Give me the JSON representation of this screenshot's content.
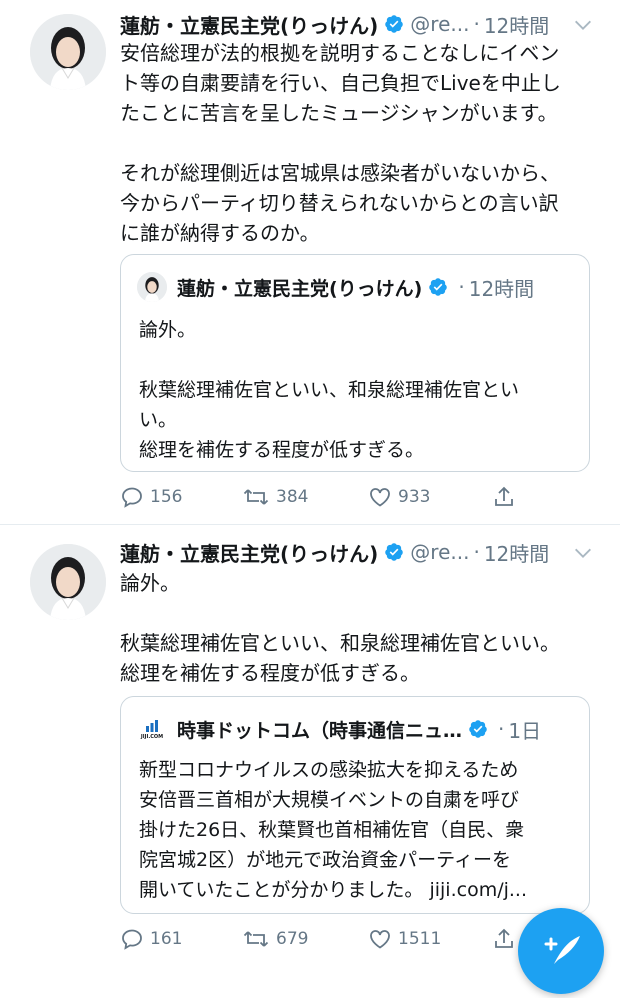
{
  "colors": {
    "accent": "#1da1f2",
    "muted": "#657786",
    "border": "#ccd6dd"
  },
  "tweets": [
    {
      "name": "蓮舫・立憲民主党(りっけん)",
      "handle": "@re...",
      "dot": "·",
      "time": "12時間",
      "body": [
        "安倍総理が法的根拠を説明することなしにイベン",
        "ト等の自粛要請を行い、自己負担でLiveを中止し",
        "たことに苦言を呈したミュージシャンがいます。",
        "",
        "それが総理側近は宮城県は感染者がいないから、",
        "今からパーティ切り替えられないからとの言い訳",
        "に誰が納得するのか。"
      ],
      "quote": {
        "name": "蓮舫・立憲民主党(りっけん)",
        "dot": "·",
        "time": "12時間",
        "text": [
          "論外。",
          "",
          "秋葉総理補佐官といい、和泉総理補佐官とい",
          "い。",
          "総理を補佐する程度が低すぎる。"
        ]
      },
      "actions": {
        "replies": "156",
        "retweets": "384",
        "likes": "933"
      }
    },
    {
      "name": "蓮舫・立憲民主党(りっけん)",
      "handle": "@re...",
      "dot": "·",
      "time": "12時間",
      "body": [
        "論外。",
        "",
        "秋葉総理補佐官といい、和泉総理補佐官といい。",
        "総理を補佐する程度が低すぎる。"
      ],
      "quote": {
        "logo_text": "JIJI.COM",
        "name": "時事ドットコム（時事通信ニュ…",
        "dot": "·",
        "time": "1日",
        "text": [
          "新型コロナウイルスの感染拡大を抑えるため",
          "安倍晋三首相が大規模イベントの自粛を呼び",
          "掛けた26日、秋葉賢也首相補佐官（自民、衆",
          "院宮城2区）が地元で政治資金パーティーを",
          "開いていたことが分かりました。 jiji.com/j..."
        ]
      },
      "actions": {
        "replies": "161",
        "retweets": "679",
        "likes": "1511"
      }
    }
  ],
  "fab_icon": "compose-tweet-icon"
}
